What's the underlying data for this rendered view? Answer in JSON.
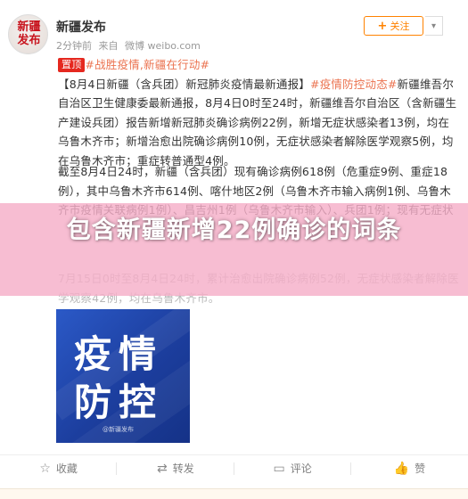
{
  "post": {
    "avatar_text": "新疆\n发布",
    "user_name": "新疆发布",
    "time": "2分钟前",
    "source_prefix": "来自",
    "source": "微博 weibo.com",
    "follow_label": "关注",
    "more_icon": "chevron-down-icon"
  },
  "content": {
    "top_badge": "置顶",
    "hashtag1": "#战胜疫情,新疆在行动#",
    "hashtag2": "#疫情防控动态#",
    "para1_part1": "【8月4日新疆（含兵团）新冠肺炎疫情最新通报】",
    "para1_part2": "新疆维吾尔自治区卫生健康委最新通报，8月4日0时至24时，新疆维吾尔自治区（含新疆生产建设兵团）报告新增新冠肺炎确诊病例22例，新增无症状感染者13例，均在乌鲁木齐市；新增治愈出院确诊病例10例，无症状感染者解除医学观察5例，均在乌鲁木齐市；重症转普通型4例。",
    "para2": "截至8月4日24时，新疆（含兵团）现有确诊病例618例（危重症9例、重症18例），其中乌鲁木齐市614例、喀什地区2例（乌鲁木齐市输入病例1例、乌鲁木齐市疫情关联病例1例）、昌吉州1例（乌鲁木齐市输入）、兵团1例；现有无症状",
    "para3": "7月15日0时至8月4日24时，累计治愈出院确诊病例52例，无症状感染者解除医学观察42例，均在乌鲁木齐市。"
  },
  "image": {
    "line1": "疫情",
    "line2": "防控",
    "watermark": "@新疆发布"
  },
  "overlay": {
    "title": "包含新疆新增22例确诊的词条"
  },
  "actions": [
    {
      "label": "收藏",
      "icon": "star-icon"
    },
    {
      "label": "转发",
      "icon": "repost-icon"
    },
    {
      "label": "评论",
      "icon": "comment-icon"
    },
    {
      "label": "赞",
      "icon": "thumbs-up-icon"
    }
  ]
}
